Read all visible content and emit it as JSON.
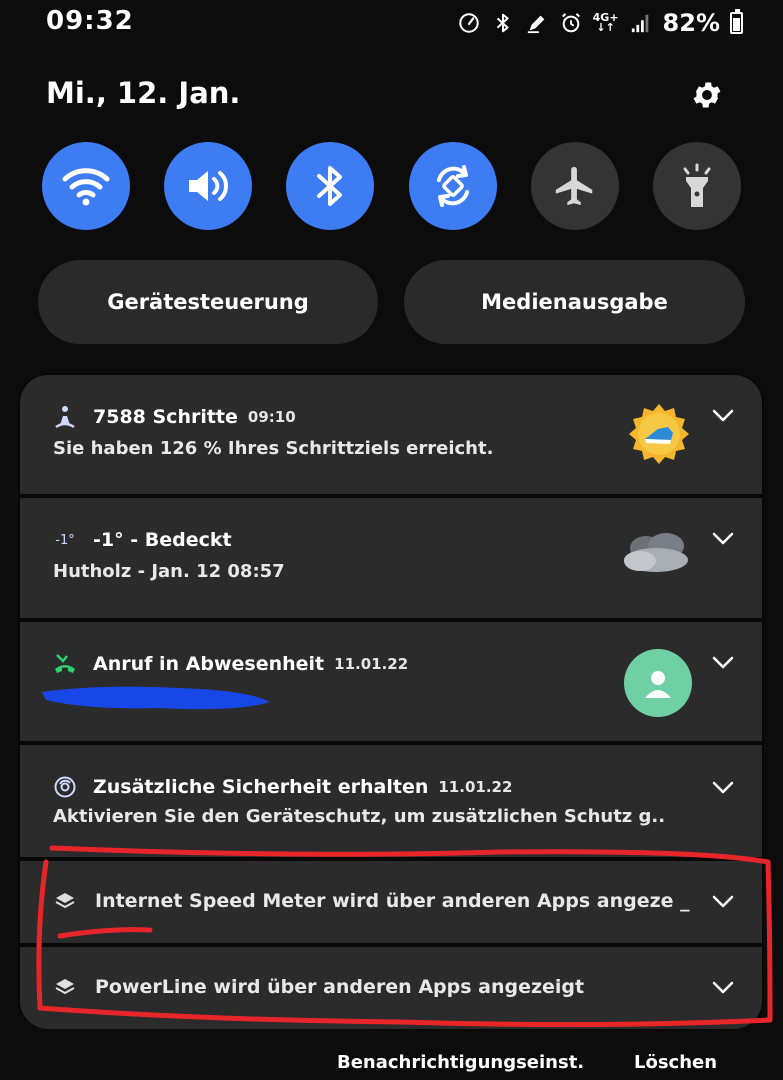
{
  "status_bar": {
    "time": "09:32",
    "network": "4G+",
    "battery_percent": "82%",
    "battery_level": 0.82,
    "icons": [
      "speedometer-icon",
      "bluetooth-icon",
      "edit-icon",
      "alarm-icon",
      "signal-icon",
      "battery-icon"
    ]
  },
  "header": {
    "date": "Mi., 12. Jan."
  },
  "quick_toggles": [
    {
      "name": "wifi",
      "state": "on"
    },
    {
      "name": "sound",
      "state": "on"
    },
    {
      "name": "bluetooth",
      "state": "on"
    },
    {
      "name": "auto-rotate",
      "state": "on"
    },
    {
      "name": "airplane-mode",
      "state": "off"
    },
    {
      "name": "flashlight",
      "state": "off"
    }
  ],
  "buttons": {
    "device_control": "Gerätesteuerung",
    "media_output": "Medienausgabe"
  },
  "notifications": [
    {
      "app_icon": "steps-icon",
      "title": "7588 Schritte",
      "time": "09:10",
      "body": "Sie haben 126 % Ihres Schrittziels erreicht.",
      "thumb": "trophy-badge-icon"
    },
    {
      "app_icon": "weather-temp-icon",
      "app_icon_text": "-1°",
      "title": "-1° -  Bedeckt",
      "time": "",
      "body": "Hutholz - Jan. 12  08:57",
      "thumb": "cloud-icon"
    },
    {
      "app_icon": "missed-call-icon",
      "title": "Anruf in Abwesenheit",
      "time": "11.01.22",
      "body": "",
      "thumb": "contact-avatar-icon"
    },
    {
      "app_icon": "security-icon",
      "title": "Zusätzliche Sicherheit erhalten",
      "time": "11.01.22",
      "body": "Aktivieren Sie den Geräteschutz, um zusätzlichen Schutz g.."
    },
    {
      "app_icon": "layers-icon",
      "title": "Internet Speed Meter wird über anderen Apps angeze _",
      "time": "",
      "body": ""
    },
    {
      "app_icon": "layers-icon",
      "title": "PowerLine wird über anderen Apps angezeigt",
      "time": "",
      "body": ""
    }
  ],
  "footer": {
    "settings_label": "Benachrichtigungseinst.",
    "clear_label": "Löschen"
  },
  "colors": {
    "accent": "#3d7cf3",
    "toggle_off": "#343434",
    "card": "#2b2b2b",
    "annotation_red": "#e8262a",
    "redaction_blue": "#1747e6",
    "missed_call_green": "#2fd06e"
  }
}
